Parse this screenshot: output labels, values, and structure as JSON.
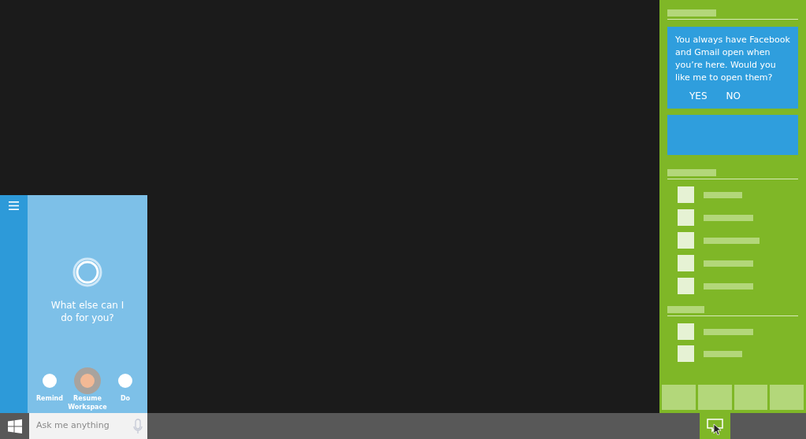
{
  "cortana": {
    "prompt": "What else can I do for you?",
    "actions": [
      {
        "label": "Remind",
        "selected": false
      },
      {
        "label": "Resume Workspace",
        "selected": true
      },
      {
        "label": "Do",
        "selected": false
      }
    ]
  },
  "taskbar": {
    "search": {
      "placeholder": "Ask me anything"
    },
    "action_center_button": {
      "selected": true
    }
  },
  "action_center": {
    "suggestion": {
      "text": "You always have Facebook and Gmail open when you’re here. Would you like me to open them?",
      "buttons": [
        "YES",
        "NO"
      ]
    }
  }
}
